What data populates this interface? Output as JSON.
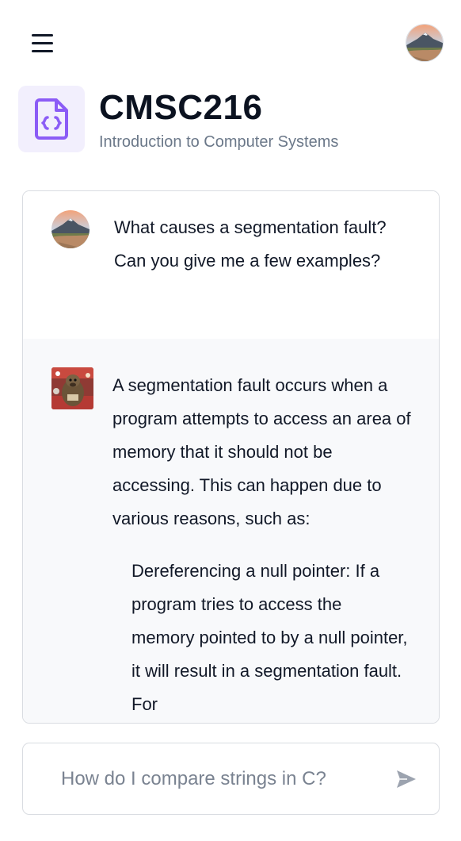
{
  "header": {
    "menu_icon": "hamburger-menu-icon",
    "profile_avatar": "landscape-avatar"
  },
  "course": {
    "icon": "code-file-icon",
    "code": "CMSC216",
    "name": "Introduction to Computer Systems",
    "accent_color": "#8b5cf6"
  },
  "chat": {
    "messages": [
      {
        "role": "user",
        "avatar": "landscape-avatar",
        "text": "What causes a segmentation fault? Can you give me a few examples?"
      },
      {
        "role": "assistant",
        "avatar": "mascot-avatar",
        "text": "A segmentation fault occurs when a program attempts to access an area of memory that it should not be accessing. This can happen due to various reasons, such as:",
        "list_item": "Dereferencing a null pointer: If a program tries to access the memory pointed to by a null pointer, it will result in a segmentation fault. For"
      }
    ]
  },
  "composer": {
    "placeholder": "How do I compare strings in C?",
    "send_icon": "send-arrow-icon"
  }
}
